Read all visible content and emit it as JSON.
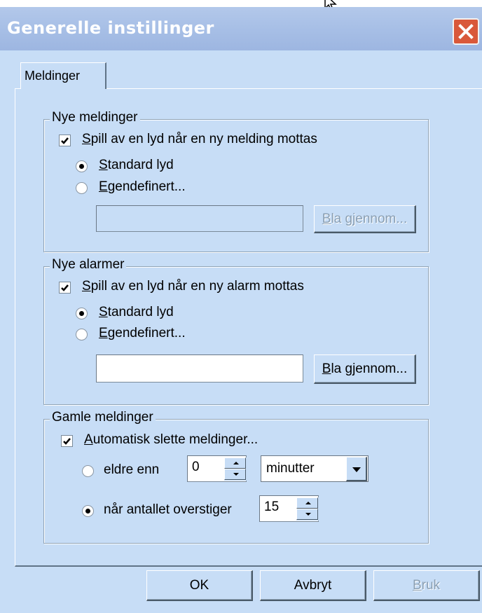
{
  "window": {
    "title": "Generelle instillinger"
  },
  "tabs": [
    {
      "label": "Meldinger",
      "selected": true
    }
  ],
  "new_messages": {
    "group_label": "Nye meldinger",
    "play_sound": {
      "label_u": "S",
      "label_rest": "pill av en lyd når en ny melding mottas",
      "checked": true
    },
    "standard": {
      "label_u": "S",
      "label_rest": "tandard lyd",
      "selected": true
    },
    "custom": {
      "label_u": "E",
      "label_rest": "gendefinert...",
      "selected": false
    },
    "path_value": "",
    "browse": {
      "label_u": "B",
      "label_rest": "la gjennom...",
      "enabled": false
    }
  },
  "new_alarms": {
    "group_label": "Nye alarmer",
    "play_sound": {
      "label_u": "S",
      "label_rest": "pill av en lyd når en ny alarm mottas",
      "checked": true
    },
    "standard": {
      "label_u": "S",
      "label_rest": "tandard lyd",
      "selected": true
    },
    "custom": {
      "label_u": "E",
      "label_rest": "gendefinert...",
      "selected": false
    },
    "path_value": "",
    "browse": {
      "label_u": "B",
      "label_rest": "la gjennom...",
      "enabled": true
    }
  },
  "old_messages": {
    "group_label": "Gamle meldinger",
    "auto_delete": {
      "label_u": "A",
      "label_rest": "utomatisk slette meldinger...",
      "checked": true
    },
    "older_than": {
      "label": "eldre enn",
      "selected": false,
      "value": "0"
    },
    "unit_select": {
      "value": "minutter"
    },
    "count_exceeds": {
      "label": "når antallet overstiger",
      "selected": true,
      "value": "15"
    }
  },
  "buttons": {
    "ok": "OK",
    "cancel": "Avbryt",
    "apply_u": "B",
    "apply_rest": "ruk"
  },
  "colors": {
    "window_bg": "#c7ddf6",
    "close_button": "#d9583a",
    "title_text": "#ffffff"
  }
}
